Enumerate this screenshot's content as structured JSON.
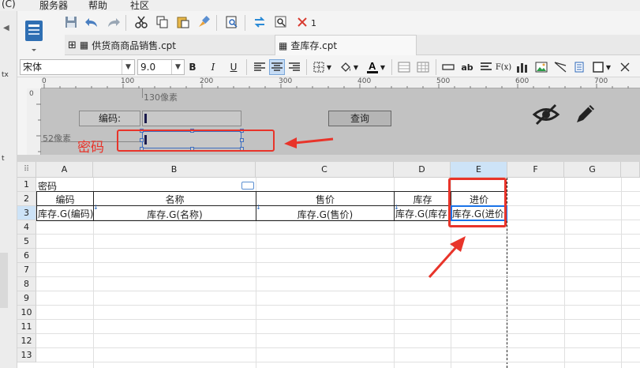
{
  "menu": {
    "prefix": "(C)",
    "items": [
      "服务器",
      "帮助",
      "社区"
    ]
  },
  "left_strip": {
    "labels": [
      "tx",
      "t"
    ]
  },
  "toolbar": {
    "delete_count": "1"
  },
  "tabs": [
    {
      "label": "供货商商品销售.cpt",
      "active": false
    },
    {
      "label": "查库存.cpt",
      "active": true
    }
  ],
  "format_bar": {
    "font_name": "宋体",
    "font_size": "9.0",
    "bold": "B",
    "italic": "I",
    "underline": "U",
    "text_label": "ab",
    "fx_label": "F(x)"
  },
  "ruler": {
    "ticks": [
      "0",
      "100",
      "200",
      "300",
      "400",
      "500",
      "600",
      "700"
    ],
    "vtick": "0"
  },
  "param_pane": {
    "width_hint": "130像素",
    "height_hint": "52像素",
    "code_label": "编码:",
    "query_button": "查询",
    "annotation": "密码"
  },
  "grid": {
    "columns": [
      "A",
      "B",
      "C",
      "D",
      "E",
      "F",
      "G"
    ],
    "rows": [
      "1",
      "2",
      "3",
      "4",
      "5",
      "6",
      "7",
      "8",
      "9",
      "10",
      "11",
      "12",
      "13"
    ],
    "cells": {
      "A1": "密码",
      "A2": "编码",
      "B2": "名称",
      "C2": "售价",
      "D2": "库存",
      "E2": "进价",
      "A3": "库存.G(编码)",
      "B3": "库存.G(名称)",
      "C3": "库存.G(售价)",
      "D3": "库存.G(库存)",
      "E3": "库存.G(进价)"
    }
  },
  "colors": {
    "accent_red": "#e8342a",
    "selection_blue": "#1a73e8",
    "pane_gray": "#c2c2c2"
  }
}
